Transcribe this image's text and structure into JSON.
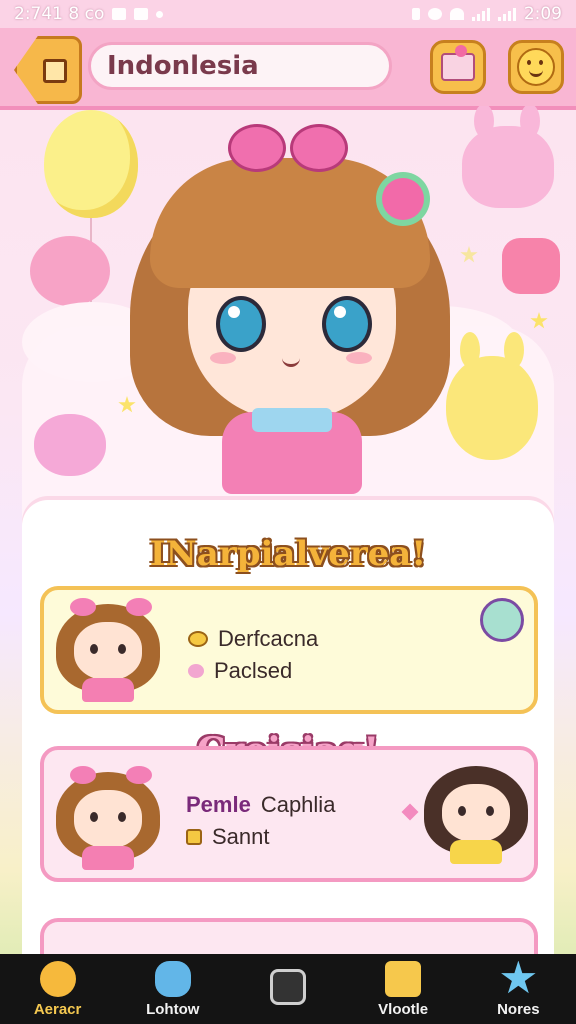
{
  "status_bar": {
    "left_text": "2:741 8 ᴄᴏ",
    "time": "2:09"
  },
  "header": {
    "search_value": "Indonlesia",
    "icons": [
      "back-grid-icon",
      "gift-icon",
      "smile-icon"
    ]
  },
  "sections": [
    {
      "title": "INarpialverea!",
      "card": {
        "line1": "Derfcacna",
        "line2": "Paclsed",
        "icons": [
          "hand-icon",
          "heart-icon",
          "heart-badge-icon"
        ]
      }
    },
    {
      "title": "Creisiag!",
      "card": {
        "line1_part1": "Pemle",
        "line1_part2": "Caphlia",
        "line2": "Sannt",
        "icons": [
          "badge-icon",
          "pink-heart-icon"
        ]
      }
    }
  ],
  "bottom_nav": [
    {
      "label": "Aeracr",
      "icon": "home-blob-icon",
      "active": true
    },
    {
      "label": "Lohtow",
      "icon": "controller-icon",
      "active": false
    },
    {
      "label": "",
      "icon": "square-icon",
      "active": false
    },
    {
      "label": "Vlootle",
      "icon": "stack-icon",
      "active": false
    },
    {
      "label": "Nores",
      "icon": "star-icon",
      "active": false
    }
  ],
  "colors": {
    "header_bg": "#f9b6d3",
    "accent_yellow": "#f4b33a",
    "accent_pink": "#f49ac2",
    "nav_bg": "#141414"
  }
}
